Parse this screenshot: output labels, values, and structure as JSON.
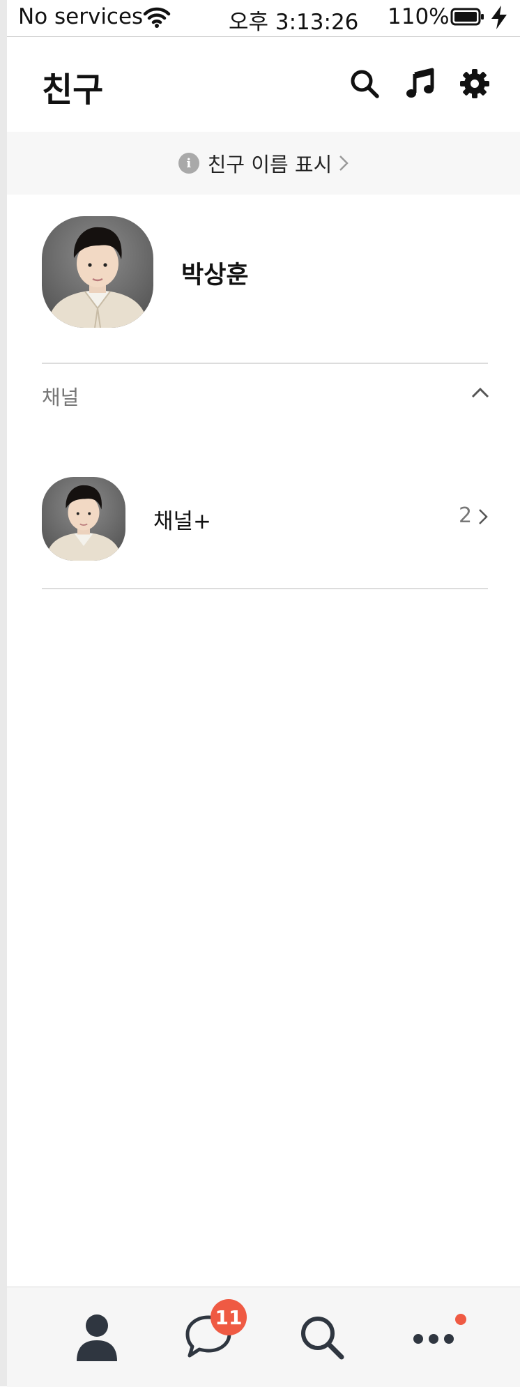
{
  "status_bar": {
    "carrier": "No services",
    "time": "오후 3:13:26",
    "battery": "110%"
  },
  "header": {
    "title": "친구",
    "icons": [
      "search-icon",
      "music-icon",
      "gear-icon"
    ]
  },
  "notice": {
    "text": "친구 이름 표시",
    "icon": "info-icon"
  },
  "profile": {
    "name": "박상훈"
  },
  "channel_section": {
    "label": "채널",
    "items": [
      {
        "label": "채널+",
        "count": "2"
      }
    ]
  },
  "tab_bar": {
    "tabs": [
      "friends-tab",
      "chats-tab",
      "search-tab",
      "more-tab"
    ],
    "chats_badge": "11"
  },
  "colors": {
    "badge": "#ef5a43",
    "icon_dark": "#2f3640"
  }
}
